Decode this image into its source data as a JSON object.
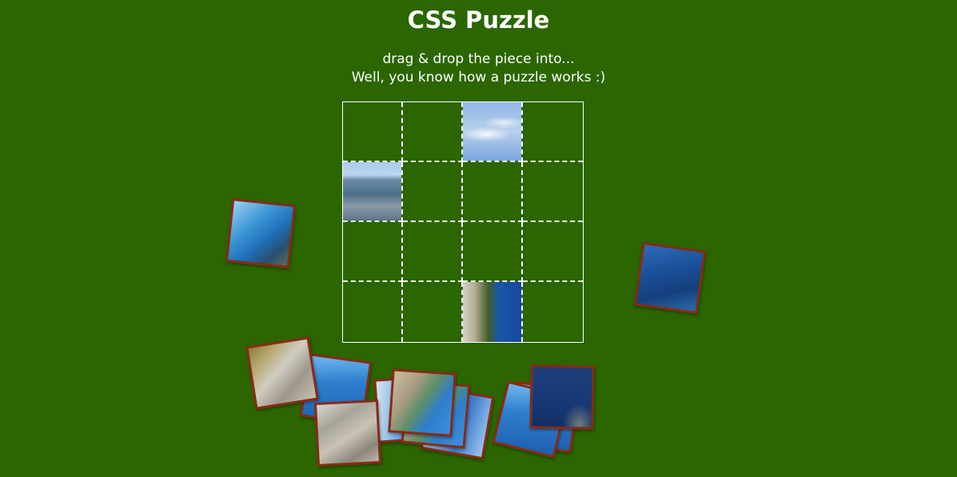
{
  "page": {
    "title": "CSS Puzzle",
    "subtitle_line1": "drag & drop the piece into...",
    "subtitle_line2": "Well, you know how a puzzle works :)"
  },
  "colors": {
    "background": "#2b6601",
    "piece_border": "#8a2a14",
    "grid_lines": "#ffffff"
  },
  "board": {
    "rows": 4,
    "cols": 4,
    "placed_pieces": [
      {
        "row": 0,
        "col": 2,
        "image": "sky-clouds"
      },
      {
        "row": 1,
        "col": 0,
        "image": "mountain-fjord"
      },
      {
        "row": 3,
        "col": 2,
        "image": "cliff-sea"
      }
    ]
  },
  "loose_pieces": [
    {
      "image": "fjord-view"
    },
    {
      "image": "deep-blue-sea"
    },
    {
      "image": "pale-blue"
    },
    {
      "image": "water"
    },
    {
      "image": "water"
    },
    {
      "image": "rock-water"
    },
    {
      "image": "pale-blue"
    },
    {
      "image": "pale-blue"
    },
    {
      "image": "rock-grass"
    },
    {
      "image": "rock"
    },
    {
      "image": "rock-water"
    },
    {
      "image": "deep-blue-sea"
    },
    {
      "image": "dark-sea-rock"
    }
  ]
}
